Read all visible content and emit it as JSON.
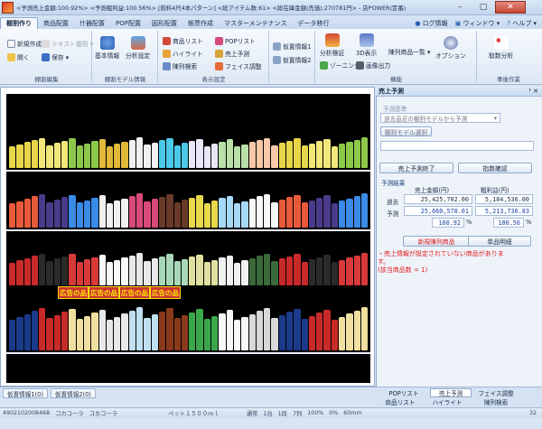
{
  "window": {
    "title": "<予測売上金額:100.92%> <予測粗利益:100.56%> [飲料4尺4本パターン] <総アイテム数:61> <総在庫金額(売価):270781円> - 店POWER(定番)",
    "minimize": "–",
    "maximize": "□",
    "close": "✕"
  },
  "tabs": [
    "棚割作り",
    "商品配置",
    "什器配置",
    "POP配置",
    "図形配置",
    "帳票作成",
    "マスターメンテナンス",
    "データ移行"
  ],
  "active_tab": "棚割作り",
  "tabbar_right": {
    "log": "ログ情報",
    "window": "ウィンドウ",
    "help": "ヘルプ"
  },
  "ribbon": {
    "edit": {
      "name": "棚割編集",
      "new": "新規作成",
      "text_shelf": "テキスト棚割 ▾",
      "open": "開く",
      "save": "保存 ▾"
    },
    "model": {
      "name": "棚割モデル情報",
      "basic": "基本情報",
      "analysis_setting": "分析設定"
    },
    "display": {
      "name": "表示設定",
      "product_list": "商品リスト",
      "highlight": "ハイライト",
      "shelf_search": "陳列検索",
      "pop_list": "POPリスト",
      "sales_forecast": "売上予測",
      "face_adjust": "フェイス調整"
    },
    "temp": {
      "info1": "仮置情報1",
      "info2": "仮置情報2"
    },
    "function": {
      "name": "機能",
      "analysis_verify": "分析検証",
      "view3d": "3D表示",
      "zoning": "ゾーニング",
      "image_output": "画像出力",
      "shelf_product_list": "陳列商品一覧 ▾",
      "option": "オプション"
    },
    "post": {
      "name": "事後作業",
      "sales_analysis": "取数分析"
    }
  },
  "ads": [
    "広告の品",
    "広告の品",
    "広告の品",
    "広告の品"
  ],
  "panel": {
    "title": "売上予測",
    "pin": "ᅡ ✕",
    "basis_label": "予測基準",
    "basis_value": "過去直近の棚割モデルから予測",
    "select_model": "棚割モデル選択",
    "end_btn": "売上予測終了",
    "confirm_btn": "指数確認",
    "result_label": "予測結果",
    "col_sales": "売上金額(円)",
    "col_profit": "粗利益(円)",
    "past_label": "過去",
    "past_sales": "25,425,702.00",
    "past_profit": "5,184,536.00",
    "forecast_label": "予測",
    "forecast_sales": "25,660,578.01",
    "forecast_profit": "5,213,736.83",
    "pct_sales": "100.92",
    "pct_profit": "100.56",
    "pct_unit": "%",
    "new_products_btn": "新規陳列商品",
    "unit_btn": "単品明細",
    "warning_line1": "・売上情報が設定されていない商品がありま",
    "warning_line2": "す。",
    "warning_line3": "(該当商品数 = 1)"
  },
  "panel_tabs": {
    "pop_list": "POPリスト",
    "sales": "売上予測",
    "face": "フェイス調整",
    "product_list": "商品リスト",
    "highlight": "ハイライト",
    "shelf_search": "陳列検索"
  },
  "bottom_tabs": [
    "仮置情報1(0)",
    "仮置情報2(0)"
  ],
  "status": {
    "jan": "4902102008468",
    "maker": "コカコーラ",
    "brand": "コカコーラ",
    "product": "ペット１５００ｍｌ",
    "normal": "通常",
    "stage": "1台",
    "tier": "1段",
    "row": "7列",
    "zoom": "100%",
    "size": "0%",
    "mm": "60mm",
    "page": "32"
  }
}
